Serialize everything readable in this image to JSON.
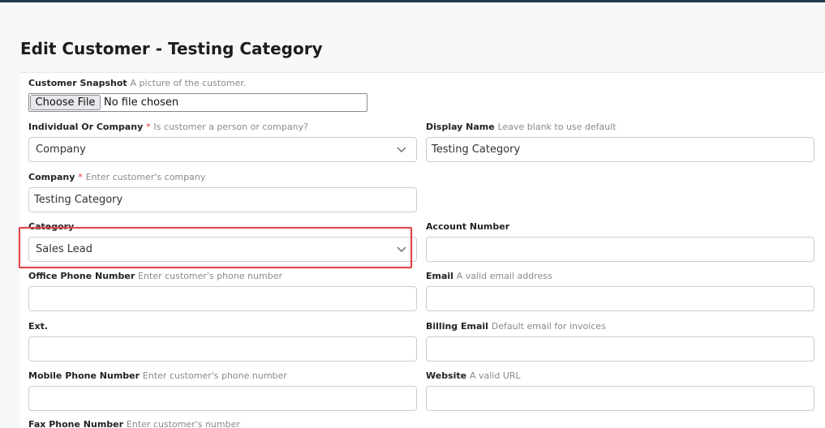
{
  "page": {
    "title": "Edit Customer - Testing Category"
  },
  "snapshot": {
    "label": "Customer Snapshot",
    "hint": "A picture of the customer.",
    "button": "Choose File",
    "status": "No file chosen"
  },
  "individual_or_company": {
    "label": "Individual Or Company",
    "required": "*",
    "hint": "Is customer a person or company?",
    "value": "Company"
  },
  "display_name": {
    "label": "Display Name",
    "hint": "Leave blank to use default",
    "value": "Testing Category"
  },
  "company": {
    "label": "Company",
    "required": "*",
    "hint": "Enter customer's company",
    "value": "Testing Category"
  },
  "category": {
    "label": "Category",
    "value": "Sales Lead"
  },
  "account_number": {
    "label": "Account Number",
    "value": ""
  },
  "office_phone": {
    "label": "Office Phone Number",
    "hint": "Enter customer's phone number",
    "value": ""
  },
  "email": {
    "label": "Email",
    "hint": "A valid email address",
    "value": ""
  },
  "ext": {
    "label": "Ext.",
    "value": ""
  },
  "billing_email": {
    "label": "Billing Email",
    "hint": "Default email for invoices",
    "value": ""
  },
  "mobile_phone": {
    "label": "Mobile Phone Number",
    "hint": "Enter customer's phone number",
    "value": ""
  },
  "website": {
    "label": "Website",
    "hint": "A valid URL",
    "value": ""
  },
  "fax_phone": {
    "label": "Fax Phone Number",
    "hint": "Enter customer's number"
  },
  "colors": {
    "highlight": "#e04646",
    "required": "#d33",
    "topbar": "#1f3a4d"
  }
}
